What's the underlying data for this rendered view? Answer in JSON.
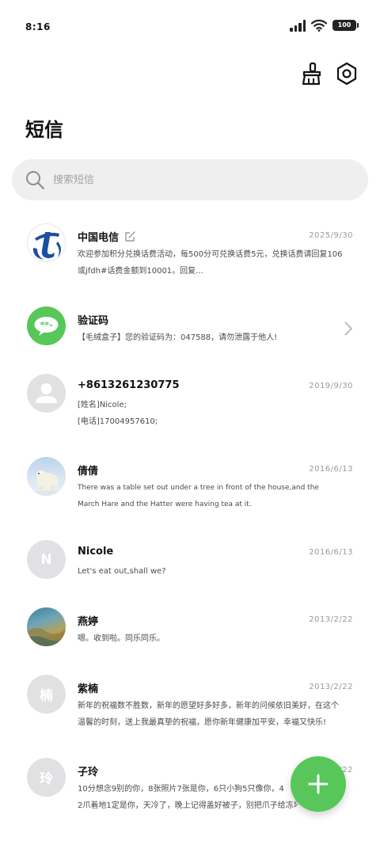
{
  "status_bar": {
    "time": "8:16",
    "battery": "100"
  },
  "header": {
    "title": "短信",
    "icons": [
      "broom-icon",
      "settings-icon"
    ]
  },
  "search": {
    "placeholder": "搜索短信",
    "icon": "search-icon"
  },
  "messages": [
    {
      "name": "中国电信",
      "date": "2025/9/30",
      "avatar": "china-telecom-logo",
      "edit_icon": "edit-icon",
      "preview1": "欢迎参加积分兑换话费活动，每500分可兑换话费5元，兑换话费请回复106",
      "preview2": "或jfdh#话费金额到10001。回复..."
    },
    {
      "name": "验证码",
      "avatar": "message-bubble-icon",
      "chevron": "chevron-right-icon",
      "preview1": "【毛绒盒子】您的验证码为：047588，请勿泄露于他人!"
    },
    {
      "name": "+8613261230775",
      "date": "2019/9/30",
      "avatar": "person-icon",
      "preview1": "[姓名]Nicole;",
      "preview2": "[电话]17004957610;"
    },
    {
      "name": "倩倩",
      "date": "2016/6/13",
      "avatar": "polar-bear-photo",
      "preview1": "There was a table set out under a tree in front of the house,and the",
      "preview2": "March Hare and the Hatter were having tea at it."
    },
    {
      "name": "Nicole",
      "date": "2016/6/13",
      "avatar_letter": "N",
      "preview1": "Let's eat out,shall we?"
    },
    {
      "name": "燕婷",
      "date": "2013/2/22",
      "avatar": "landscape-photo",
      "preview1": "嗯。收到啦。同乐同乐。"
    },
    {
      "name": "紫楠",
      "date": "2013/2/22",
      "avatar_letter": "楠",
      "preview1": "新年的祝福数不胜数，新年的愿望好多好多，新年的问候依旧美好，在这个",
      "preview2": "温馨的时刻，送上我最真挚的祝福，愿你新年健康加平安，幸福又快乐!"
    },
    {
      "name": "子玲",
      "date": "2013/2/22",
      "avatar_letter": "玲",
      "preview1": "10分想念9别的你，8张照片7张是你，6只小狗5只像你，4",
      "preview2": "2爪着地1定是你，天冷了，晚上记得盖好被子，别把爪子给冻坏"
    }
  ],
  "fab": {
    "icon": "plus-icon"
  },
  "colors": {
    "accent": "#56c758",
    "search_bg": "#efefef",
    "avatar_bg": "#e1e1e3",
    "telecom_blue": "#1d4fa1"
  }
}
